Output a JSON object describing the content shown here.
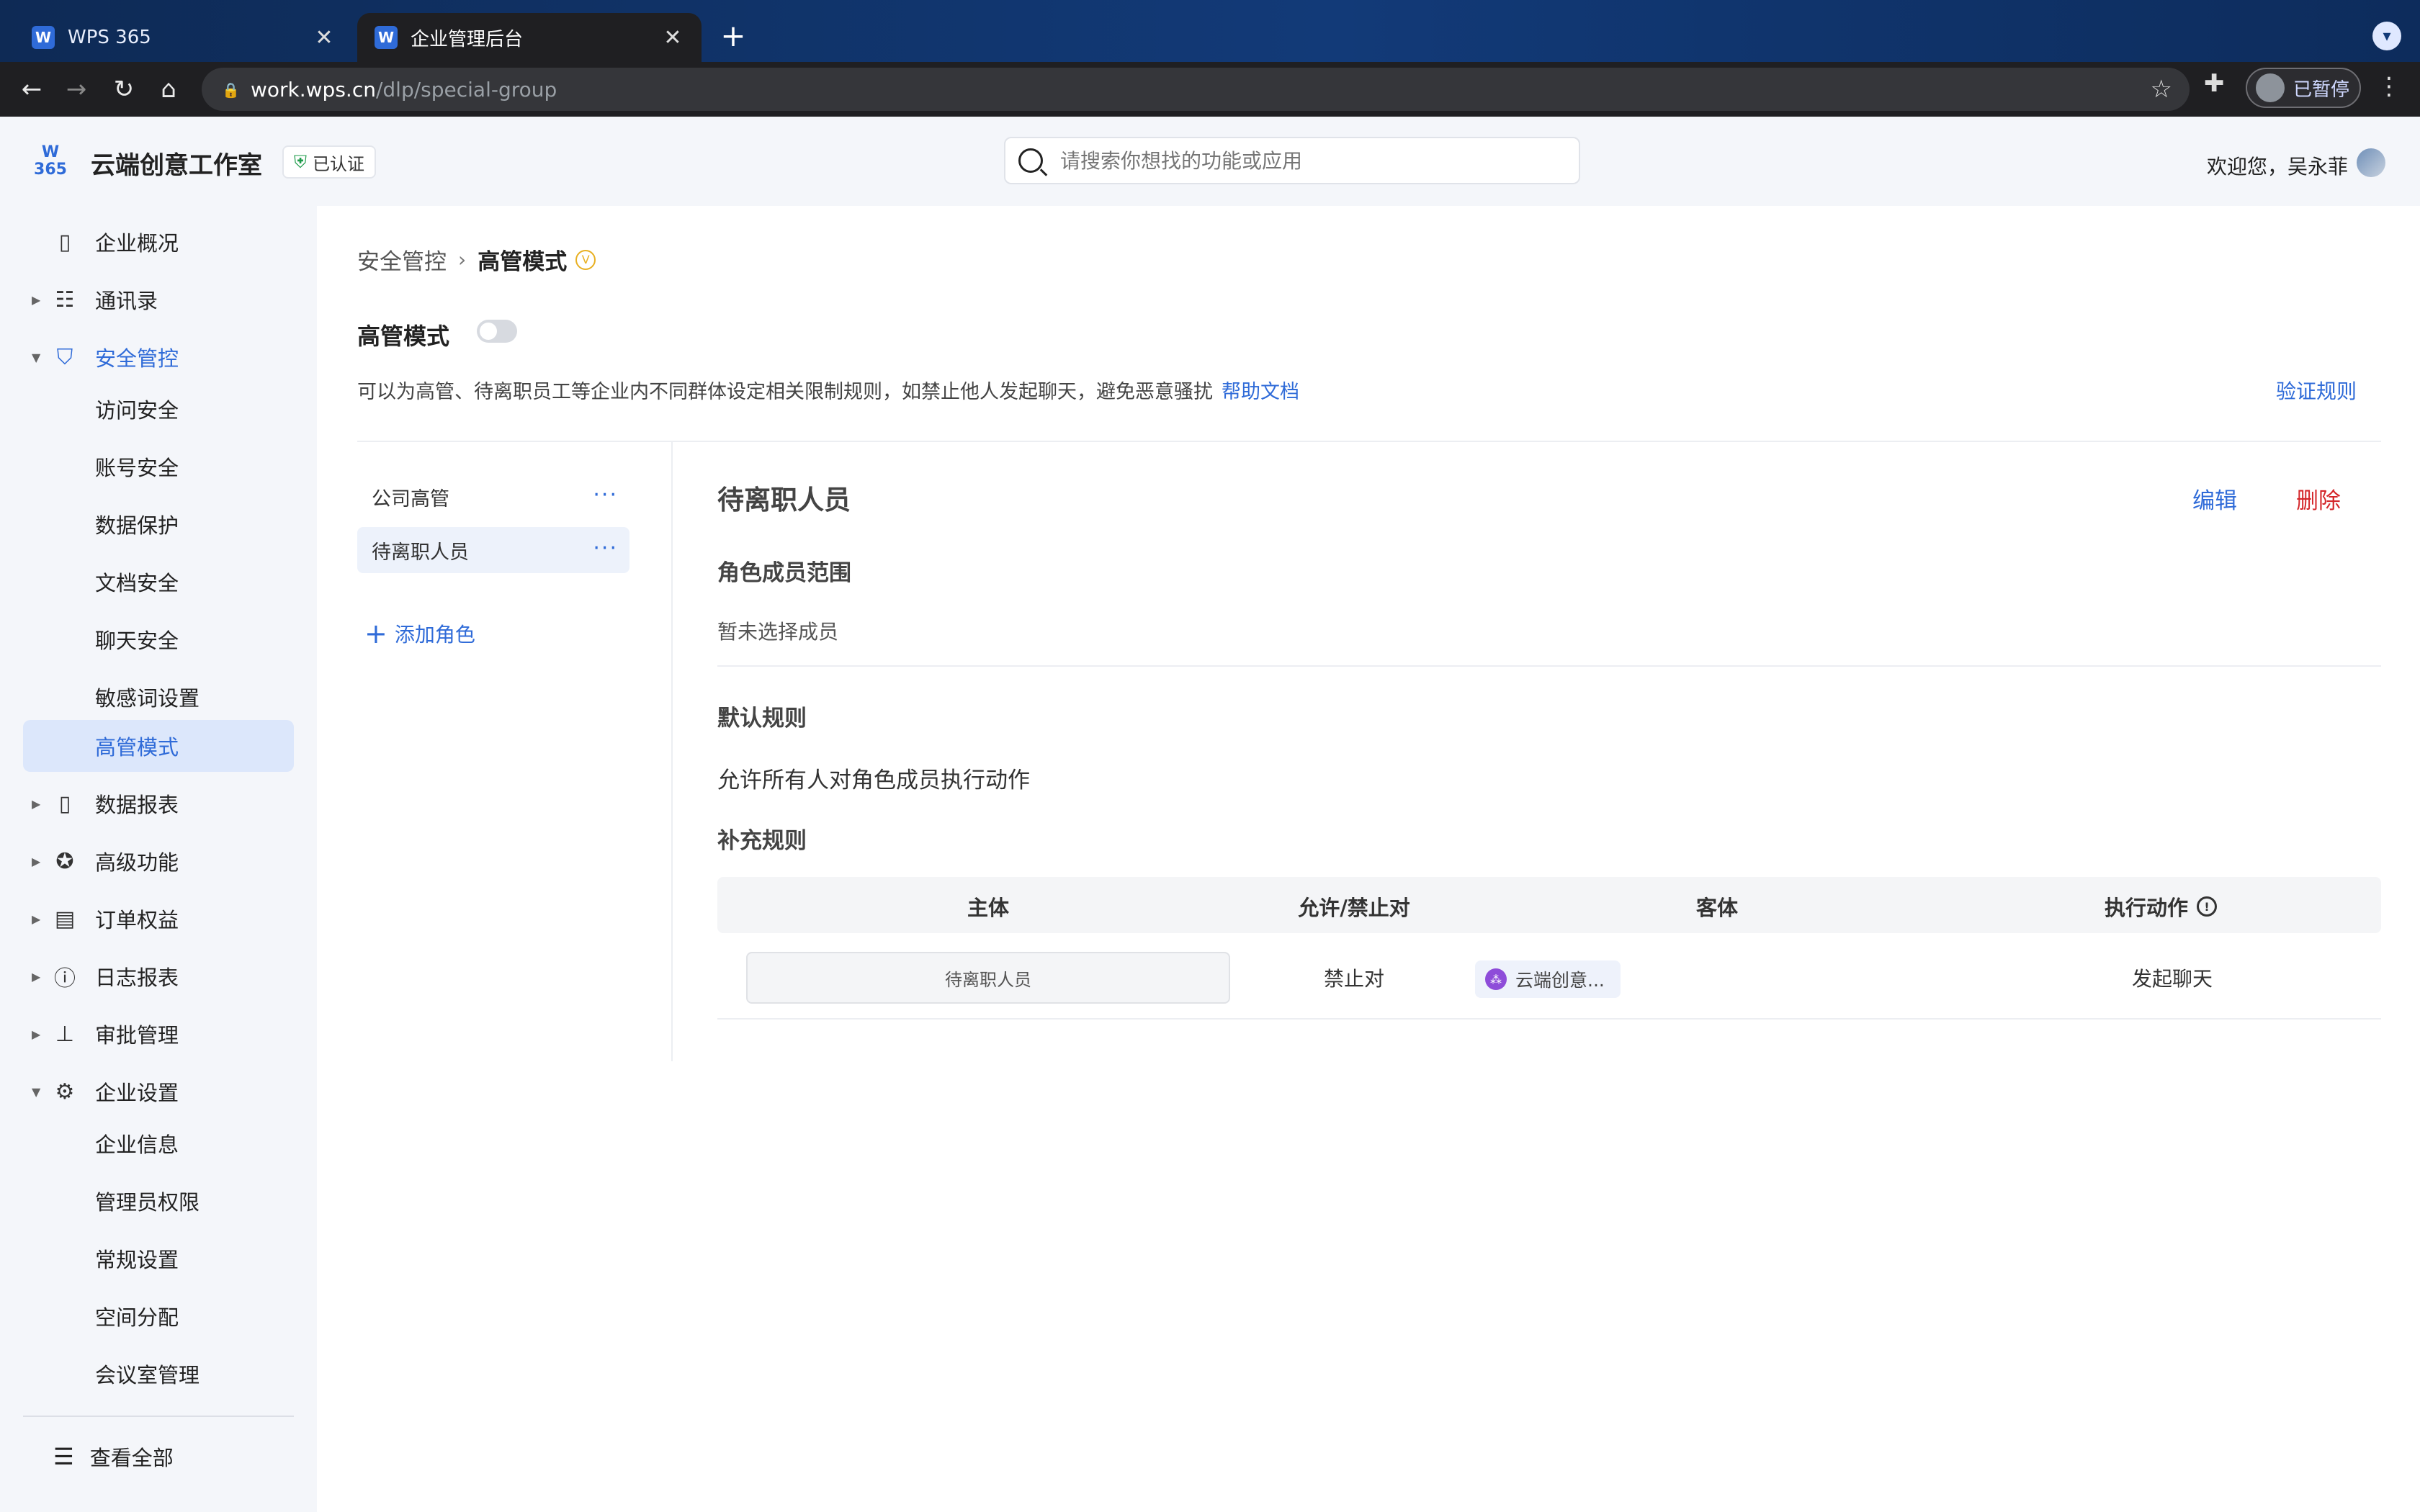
{
  "browser": {
    "tabs": [
      {
        "title": "WPS 365",
        "favicon": "W",
        "active": false
      },
      {
        "title": "企业管理后台",
        "favicon": "W",
        "active": true
      }
    ],
    "url_host": "work.wps.cn",
    "url_path": "/dlp/special-group",
    "profile_status": "已暂停",
    "icons": [
      "back-arrow-icon",
      "forward-arrow-icon",
      "reload-icon",
      "home-icon",
      "lock-icon",
      "star-icon",
      "puzzle-icon",
      "kebab-menu-icon",
      "new-tab-plus-icon",
      "close-icon"
    ]
  },
  "header": {
    "logo_text": "W 365",
    "org_name": "云端创意工作室",
    "verified_label": "已认证",
    "search_placeholder": "请搜索你想找的功能或应用",
    "welcome": "欢迎您，吴永菲",
    "accent_color": "#2f6bd8"
  },
  "sidebar": {
    "items": [
      {
        "label": "企业概况",
        "icon": "building-icon",
        "level": 1,
        "expandable": false
      },
      {
        "label": "通讯录",
        "icon": "contacts-icon",
        "level": 1,
        "expandable": true
      },
      {
        "label": "安全管控",
        "icon": "shield-check-icon",
        "level": 1,
        "expandable": true,
        "expanded": true
      },
      {
        "label": "访问安全",
        "level": 2
      },
      {
        "label": "账号安全",
        "level": 2
      },
      {
        "label": "数据保护",
        "level": 2
      },
      {
        "label": "文档安全",
        "level": 2
      },
      {
        "label": "聊天安全",
        "level": 2
      },
      {
        "label": "敏感词设置",
        "level": 2
      },
      {
        "label": "高管模式",
        "level": 2,
        "active": true
      },
      {
        "label": "数据报表",
        "icon": "report-icon",
        "level": 1,
        "expandable": true
      },
      {
        "label": "高级功能",
        "icon": "badge-check-icon",
        "level": 1,
        "expandable": true
      },
      {
        "label": "订单权益",
        "icon": "clipboard-icon",
        "level": 1,
        "expandable": true
      },
      {
        "label": "日志报表",
        "icon": "info-doc-icon",
        "level": 1,
        "expandable": true
      },
      {
        "label": "审批管理",
        "icon": "stamp-icon",
        "level": 1,
        "expandable": true
      },
      {
        "label": "企业设置",
        "icon": "gear-icon",
        "level": 1,
        "expandable": true,
        "expanded": true
      },
      {
        "label": "企业信息",
        "level": 2
      },
      {
        "label": "管理员权限",
        "level": 2
      },
      {
        "label": "常规设置",
        "level": 2
      },
      {
        "label": "空间分配",
        "level": 2
      },
      {
        "label": "会议室管理",
        "level": 2
      }
    ],
    "view_all": "查看全部"
  },
  "main": {
    "breadcrumb": [
      "安全管控",
      "高管模式"
    ],
    "vip_badge": "V",
    "mode_label": "高管模式",
    "mode_enabled": false,
    "description": "可以为高管、待离职员工等企业内不同群体设定相关限制规则，如禁止他人发起聊天，避免恶意骚扰",
    "help_link": "帮助文档",
    "verify_link": "验证规则",
    "roles": [
      {
        "label": "公司高管",
        "selected": false
      },
      {
        "label": "待离职人员",
        "selected": true
      }
    ],
    "add_role": "添加角色",
    "detail": {
      "title": "待离职人员",
      "edit": "编辑",
      "delete": "删除",
      "member_scope_heading": "角色成员范围",
      "member_scope_empty": "暂未选择成员",
      "default_rule_heading": "默认规则",
      "default_rule_text": "允许所有人对角色成员执行动作",
      "extra_rule_heading": "补充规则",
      "table": {
        "headers": [
          "主体",
          "允许/禁止对",
          "客体",
          "执行动作"
        ],
        "rows": [
          {
            "subject": "待离职人员",
            "permission": "禁止对",
            "object": "云端创意...",
            "action": "发起聊天"
          }
        ]
      }
    }
  }
}
